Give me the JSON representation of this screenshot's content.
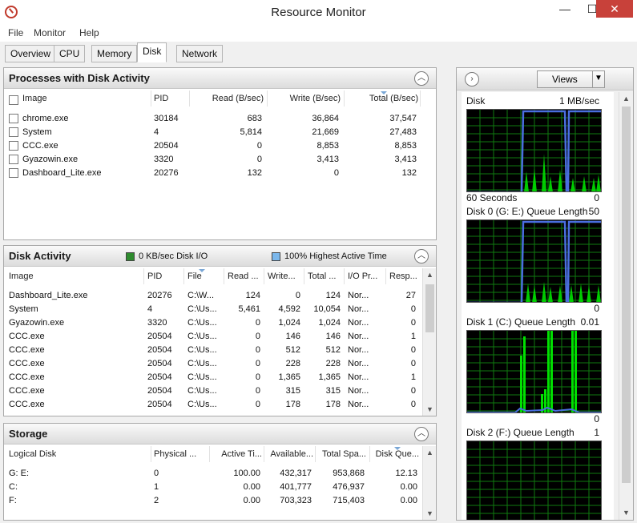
{
  "window": {
    "title": "Resource Monitor",
    "minimize": "—",
    "maximize": "☐",
    "close": "✕"
  },
  "menu": [
    "File",
    "Monitor",
    "Help"
  ],
  "tabs": [
    "Overview",
    "CPU",
    "Memory",
    "Disk",
    "Network"
  ],
  "active_tab": "Disk",
  "processes": {
    "title": "Processes with Disk Activity",
    "columns": [
      "Image",
      "PID",
      "Read (B/sec)",
      "Write (B/sec)",
      "Total (B/sec)"
    ],
    "rows": [
      [
        "chrome.exe",
        "30184",
        "683",
        "36,864",
        "37,547"
      ],
      [
        "System",
        "4",
        "5,814",
        "21,669",
        "27,483"
      ],
      [
        "CCC.exe",
        "20504",
        "0",
        "8,853",
        "8,853"
      ],
      [
        "Gyazowin.exe",
        "3320",
        "0",
        "3,413",
        "3,413"
      ],
      [
        "Dashboard_Lite.exe",
        "20276",
        "132",
        "0",
        "132"
      ]
    ]
  },
  "disk_activity": {
    "title": "Disk Activity",
    "legend_io": "0 KB/sec Disk I/O",
    "legend_active": "100% Highest Active Time",
    "legend_io_color": "#2e8b2e",
    "legend_active_color": "#7cb8ec",
    "columns": [
      "Image",
      "PID",
      "File",
      "Read ...",
      "Write...",
      "Total ...",
      "I/O Pr...",
      "Resp..."
    ],
    "rows": [
      [
        "Dashboard_Lite.exe",
        "20276",
        "C:\\W...",
        "124",
        "0",
        "124",
        "Nor...",
        "27"
      ],
      [
        "System",
        "4",
        "C:\\Us...",
        "5,461",
        "4,592",
        "10,054",
        "Nor...",
        "0"
      ],
      [
        "Gyazowin.exe",
        "3320",
        "C:\\Us...",
        "0",
        "1,024",
        "1,024",
        "Nor...",
        "0"
      ],
      [
        "CCC.exe",
        "20504",
        "C:\\Us...",
        "0",
        "146",
        "146",
        "Nor...",
        "1"
      ],
      [
        "CCC.exe",
        "20504",
        "C:\\Us...",
        "0",
        "512",
        "512",
        "Nor...",
        "0"
      ],
      [
        "CCC.exe",
        "20504",
        "C:\\Us...",
        "0",
        "228",
        "228",
        "Nor...",
        "0"
      ],
      [
        "CCC.exe",
        "20504",
        "C:\\Us...",
        "0",
        "1,365",
        "1,365",
        "Nor...",
        "1"
      ],
      [
        "CCC.exe",
        "20504",
        "C:\\Us...",
        "0",
        "315",
        "315",
        "Nor...",
        "0"
      ],
      [
        "CCC.exe",
        "20504",
        "C:\\Us...",
        "0",
        "178",
        "178",
        "Nor...",
        "0"
      ]
    ]
  },
  "storage": {
    "title": "Storage",
    "columns": [
      "Logical Disk",
      "Physical ...",
      "Active Ti...",
      "Available...",
      "Total Spa...",
      "Disk Que..."
    ],
    "rows": [
      [
        "G: E:",
        "0",
        "100.00",
        "432,317",
        "953,868",
        "12.13"
      ],
      [
        "C:",
        "1",
        "0.00",
        "401,777",
        "476,937",
        "0.00"
      ],
      [
        "F:",
        "2",
        "0.00",
        "703,323",
        "715,403",
        "0.00"
      ]
    ]
  },
  "graphs": {
    "views_label": "Views",
    "disk": {
      "label": "Disk",
      "scale": "1 MB/sec",
      "time": "60 Seconds",
      "min": "0"
    },
    "disk0": {
      "label": "Disk 0 (G: E:) Queue Length",
      "scale": "50",
      "min": "0"
    },
    "disk1": {
      "label": "Disk 1 (C:) Queue Length",
      "scale": "0.01",
      "min": "0"
    },
    "disk2": {
      "label": "Disk 2 (F:) Queue Length",
      "scale": "1"
    }
  },
  "colors": {
    "grid": "#0f7a0f",
    "activity": "#00e000",
    "active_time": "#4a6ee0",
    "close": "#c8413a"
  }
}
